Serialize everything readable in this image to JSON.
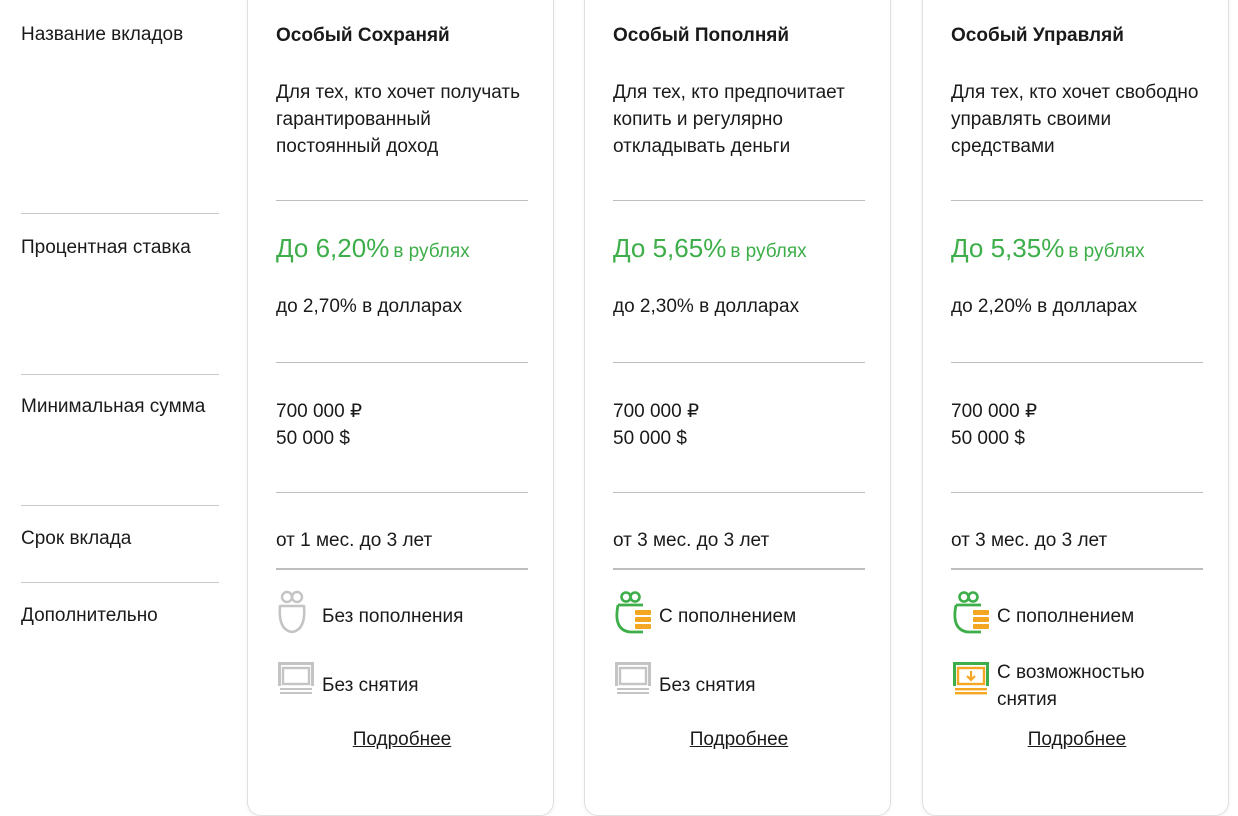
{
  "labels": {
    "name": "Название вкладов",
    "rate": "Процентная ставка",
    "min_sum": "Минимальная сумма",
    "term": "Срок вклада",
    "extra": "Дополнительно"
  },
  "colors": {
    "accent_green": "#3dae49",
    "accent_orange": "#f5a623",
    "muted_gray": "#c4c4c4"
  },
  "cards": [
    {
      "title": "Особый Сохраняй",
      "description": "Для тех, кто хочет получать гарантированный постоянный доход",
      "rate_main": "До 6,20%",
      "rate_suffix": "в рублях",
      "rate_usd": "до 2,70% в долларах",
      "min_rub": "700 000 ₽",
      "min_usd": "50 000 $",
      "term": "от 1 мес. до 3 лет",
      "feature_topup": {
        "text": "Без пополнения",
        "icon": "wallet-icon",
        "active": false
      },
      "feature_withdraw": {
        "text": "Без снятия",
        "icon": "withdraw-icon",
        "active": false
      },
      "more": "Подробнее"
    },
    {
      "title": "Особый Пополняй",
      "description": "Для тех, кто предпочитает копить и регулярно откладывать деньги",
      "rate_main": "До 5,65%",
      "rate_suffix": "в рублях",
      "rate_usd": "до 2,30% в долларах",
      "min_rub": "700 000 ₽",
      "min_usd": "50 000 $",
      "term": "от 3 мес. до 3 лет",
      "feature_topup": {
        "text": "С пополнением",
        "icon": "wallet-icon",
        "active": true
      },
      "feature_withdraw": {
        "text": "Без снятия",
        "icon": "withdraw-icon",
        "active": false
      },
      "more": "Подробнее"
    },
    {
      "title": "Особый Управляй",
      "description": "Для тех, кто хочет свободно управлять своими средствами",
      "rate_main": "До 5,35%",
      "rate_suffix": "в рублях",
      "rate_usd": "до 2,20% в долларах",
      "min_rub": "700 000 ₽",
      "min_usd": "50 000 $",
      "term": "от 3 мес. до 3 лет",
      "feature_topup": {
        "text": "С пополнением",
        "icon": "wallet-icon",
        "active": true
      },
      "feature_withdraw": {
        "text": "С возможностью снятия",
        "icon": "withdraw-icon",
        "active": true
      },
      "more": "Подробнее"
    }
  ]
}
